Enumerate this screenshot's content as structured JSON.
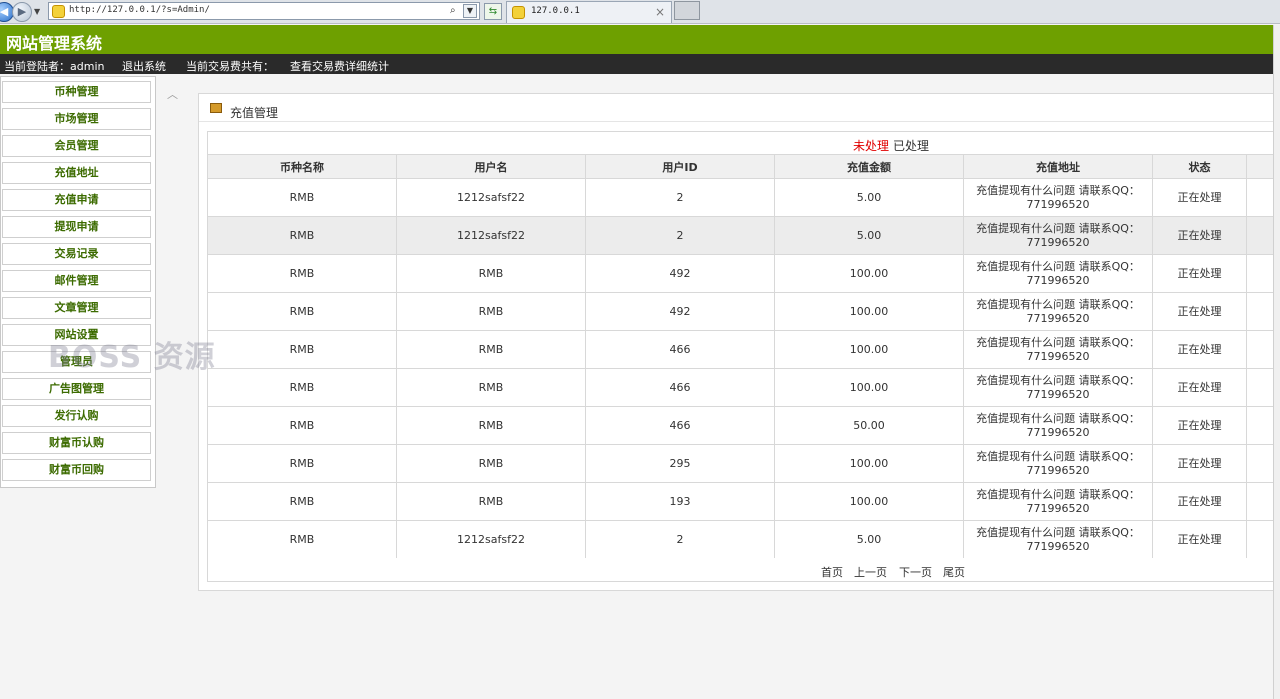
{
  "browser": {
    "url": "http://127.0.0.1/?s=Admin/",
    "tab_title": "127.0.0.1",
    "tab_close": "×"
  },
  "header": {
    "title": "网站管理系统"
  },
  "info_bar": {
    "current_user": "当前登陆者：admin",
    "logout": "退出系统",
    "fee_total": "当前交易费共有：",
    "fee_stats": "查看交易费详细统计"
  },
  "sidebar": {
    "items": [
      {
        "label": "币种管理"
      },
      {
        "label": "市场管理"
      },
      {
        "label": "会员管理"
      },
      {
        "label": "充值地址"
      },
      {
        "label": "充值申请"
      },
      {
        "label": "提现申请"
      },
      {
        "label": "交易记录"
      },
      {
        "label": "邮件管理"
      },
      {
        "label": "文章管理"
      },
      {
        "label": "网站设置"
      },
      {
        "label": "管理员"
      },
      {
        "label": "广告图管理"
      },
      {
        "label": "发行认购"
      },
      {
        "label": "财富币认购"
      },
      {
        "label": "财富币回购"
      }
    ]
  },
  "panel": {
    "title": "充值管理",
    "filters": {
      "unprocessed": "未处理",
      "processed": "已处理"
    }
  },
  "table": {
    "headers": [
      "币种名称",
      "用户名",
      "用户ID",
      "充值金额",
      "充值地址",
      "状态",
      ""
    ],
    "rows": [
      {
        "currency": "RMB",
        "username": "1212safsf22",
        "user_id": "2",
        "amount": "5.00",
        "address": "充值提现有什么问题 请联系QQ：771996520",
        "status": "正在处理"
      },
      {
        "currency": "RMB",
        "username": "1212safsf22",
        "user_id": "2",
        "amount": "5.00",
        "address": "充值提现有什么问题 请联系QQ：771996520",
        "status": "正在处理"
      },
      {
        "currency": "RMB",
        "username": "RMB",
        "user_id": "492",
        "amount": "100.00",
        "address": "充值提现有什么问题 请联系QQ：771996520",
        "status": "正在处理"
      },
      {
        "currency": "RMB",
        "username": "RMB",
        "user_id": "492",
        "amount": "100.00",
        "address": "充值提现有什么问题 请联系QQ：771996520",
        "status": "正在处理"
      },
      {
        "currency": "RMB",
        "username": "RMB",
        "user_id": "466",
        "amount": "100.00",
        "address": "充值提现有什么问题 请联系QQ：771996520",
        "status": "正在处理"
      },
      {
        "currency": "RMB",
        "username": "RMB",
        "user_id": "466",
        "amount": "100.00",
        "address": "充值提现有什么问题 请联系QQ：771996520",
        "status": "正在处理"
      },
      {
        "currency": "RMB",
        "username": "RMB",
        "user_id": "466",
        "amount": "50.00",
        "address": "充值提现有什么问题 请联系QQ：771996520",
        "status": "正在处理"
      },
      {
        "currency": "RMB",
        "username": "RMB",
        "user_id": "295",
        "amount": "100.00",
        "address": "充值提现有什么问题 请联系QQ：771996520",
        "status": "正在处理"
      },
      {
        "currency": "RMB",
        "username": "RMB",
        "user_id": "193",
        "amount": "100.00",
        "address": "充值提现有什么问题 请联系QQ：771996520",
        "status": "正在处理"
      },
      {
        "currency": "RMB",
        "username": "1212safsf22",
        "user_id": "2",
        "amount": "5.00",
        "address": "充值提现有什么问题 请联系QQ：771996520",
        "status": "正在处理"
      }
    ]
  },
  "pager": {
    "first": "首页",
    "prev": "上一页",
    "next": "下一页",
    "last": "尾页"
  },
  "watermark": "BOSS 资源",
  "colors": {
    "header_green": "#6ea000",
    "info_bar_dark": "#2a2a2a",
    "sidebar_text_green": "#3c6b00",
    "filter_active_red": "#e00000"
  }
}
